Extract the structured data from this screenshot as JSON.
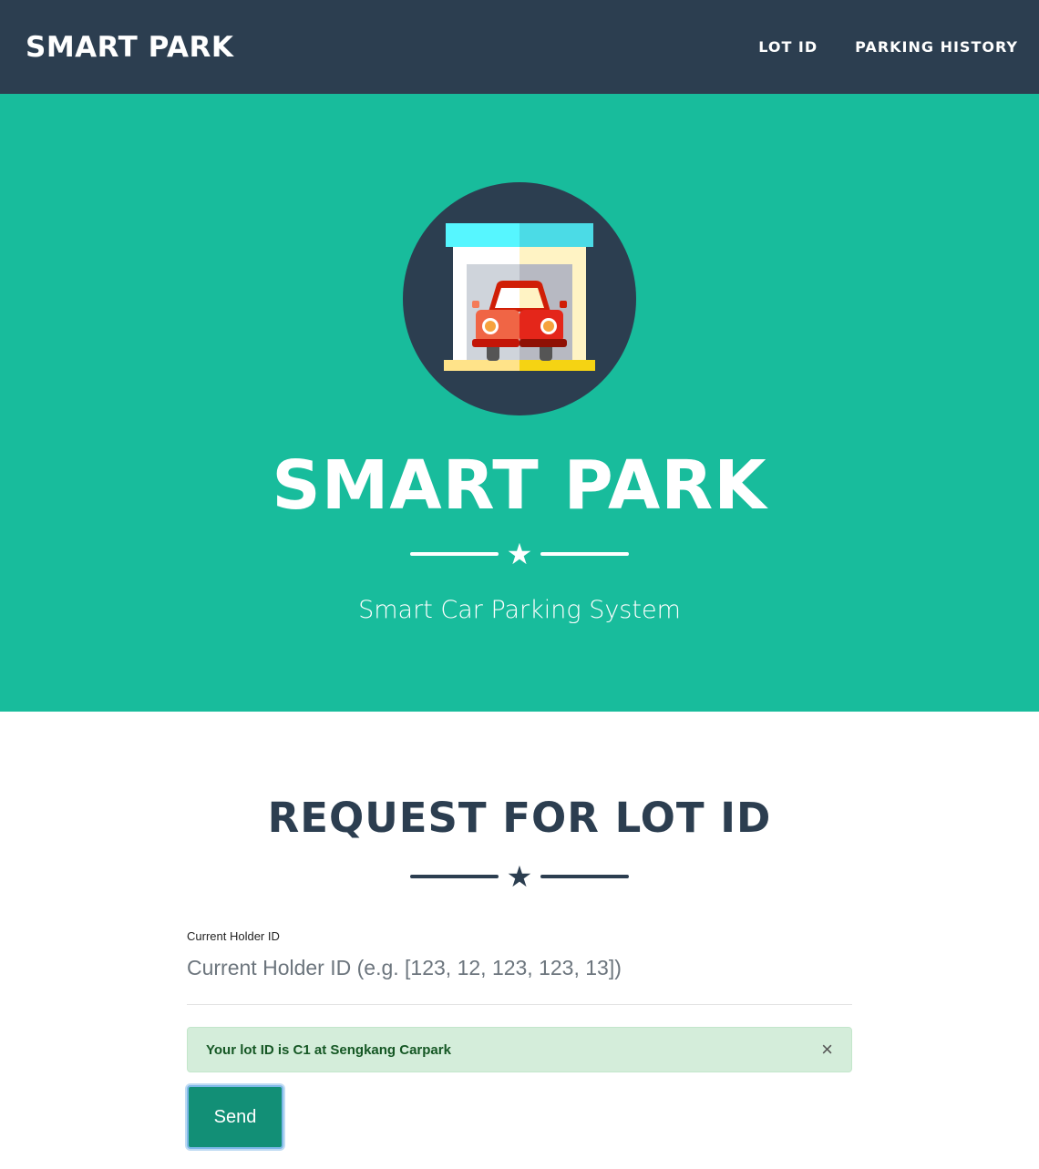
{
  "navbar": {
    "brand": "SMART PARK",
    "links": [
      "LOT ID",
      "PARKING HISTORY"
    ]
  },
  "hero": {
    "title": "SMART PARK",
    "subtitle": "Smart Car Parking System",
    "divider_icon": "star-icon",
    "logo_icon": "car-garage-icon"
  },
  "request": {
    "title": "REQUEST FOR LOT ID",
    "divider_icon": "star-icon",
    "field_label": "Current Holder ID",
    "field_placeholder": "Current Holder ID (e.g. [123, 12, 123, 123, 13])",
    "alert_text": "Your lot ID is C1 at Sengkang Carpark",
    "alert_close": "×",
    "send_label": "Send"
  },
  "colors": {
    "navbar": "#2c3e50",
    "hero": "#18bc9c",
    "button": "#128f76",
    "alert_bg": "#d4edda",
    "alert_text": "#155724"
  }
}
